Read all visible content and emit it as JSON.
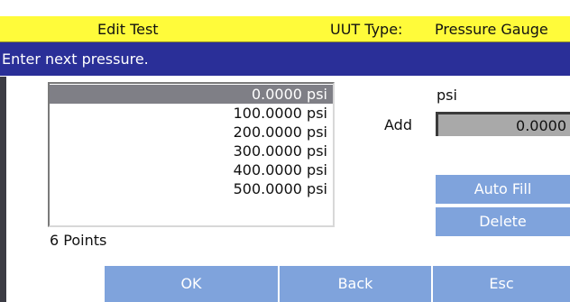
{
  "header": {
    "title": "Edit Test",
    "uut_type_label": "UUT Type:",
    "uut_type_value": "Pressure Gauge"
  },
  "prompt": "Enter next pressure.",
  "pressure_list": {
    "items": [
      "0.0000 psi",
      "100.0000 psi",
      "200.0000 psi",
      "300.0000 psi",
      "400.0000 psi",
      "500.0000 psi"
    ],
    "selected_index": 0,
    "count_label": "6 Points"
  },
  "add_panel": {
    "unit": "psi",
    "add_label": "Add",
    "value": "0.0000"
  },
  "buttons": {
    "auto_fill": "Auto Fill",
    "delete": "Delete",
    "ok": "OK",
    "back": "Back",
    "esc": "Esc"
  },
  "colors": {
    "title_bar": "#fffb3a",
    "prompt_bar": "#2a2f98",
    "button": "#7fa3dc",
    "selection": "#7f7f86",
    "input_bg": "#a9a9a9"
  }
}
